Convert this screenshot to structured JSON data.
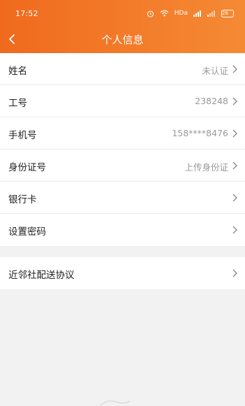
{
  "status_bar": {
    "time": "17:52",
    "signal_label": "HDa",
    "battery": "26"
  },
  "nav": {
    "title": "个人信息"
  },
  "profile_rows": [
    {
      "label": "姓名",
      "value": "未认证"
    },
    {
      "label": "工号",
      "value": "238248"
    },
    {
      "label": "手机号",
      "value": "158****8476"
    },
    {
      "label": "身份证号",
      "value": "上传身份证"
    },
    {
      "label": "银行卡",
      "value": ""
    },
    {
      "label": "设置密码",
      "value": ""
    }
  ],
  "agreement_row": {
    "label": "近邻社配送协议"
  },
  "colors": {
    "header_start": "#f06a1e",
    "header_end": "#f58a34",
    "background": "#f2f2f2"
  }
}
